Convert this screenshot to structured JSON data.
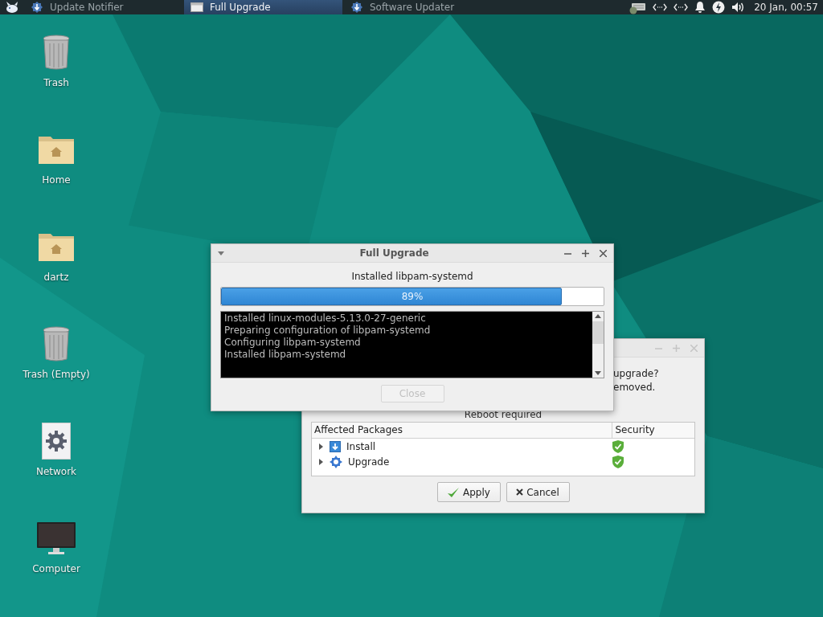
{
  "taskbar": {
    "tasks": [
      {
        "label": "Update Notifier",
        "kind": "updater",
        "selected": false
      },
      {
        "label": "Full Upgrade",
        "kind": "window",
        "selected": true
      },
      {
        "label": "Software Updater",
        "kind": "updater",
        "selected": false
      }
    ],
    "clock": "20 Jan, 00:57"
  },
  "desktop_icons": [
    {
      "label": "Trash",
      "kind": "trash"
    },
    {
      "label": "Home",
      "kind": "folder"
    },
    {
      "label": "dartz",
      "kind": "folder"
    },
    {
      "label": "Trash (Empty)",
      "kind": "trash"
    },
    {
      "label": "Network",
      "kind": "network"
    },
    {
      "label": "Computer",
      "kind": "computer"
    }
  ],
  "back_dialog": {
    "question_lines": [
      "upgrade?",
      "emoved."
    ],
    "notice": "Reboot required",
    "table": {
      "columns": [
        "Affected Packages",
        "Security"
      ],
      "rows": [
        {
          "label": "Install",
          "kind": "install",
          "expanded": false
        },
        {
          "label": "Upgrade",
          "kind": "upgrade",
          "expanded": false
        }
      ]
    },
    "buttons": [
      {
        "label": "Apply",
        "kind": "apply"
      },
      {
        "label": "Cancel",
        "kind": "cancel"
      }
    ]
  },
  "progress_dialog": {
    "title": "Full Upgrade",
    "status": "Installed libpam-systemd",
    "progress": {
      "level": 0.89,
      "reading": "89%"
    },
    "log": [
      "Installed linux-modules-5.13.0-27-generic",
      "Preparing configuration of libpam-systemd",
      "Configuring libpam-systemd",
      "Installed libpam-systemd"
    ],
    "button": {
      "label": "Close",
      "disabled": true
    }
  }
}
